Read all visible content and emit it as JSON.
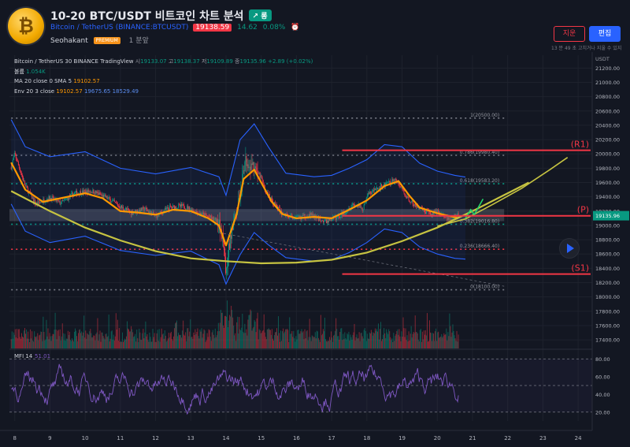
{
  "header": {
    "title": "10-20 BTC/USDT 비트코인 차트 분석",
    "trend_badge": "↗ 롱",
    "symbol_name": "Bitcoin / TetherUS",
    "symbol_code": "(BINANCE:BTCUSDT)",
    "price": "19138.59",
    "change": "14.62",
    "change_pct": "0.08%",
    "author": "Seohakant",
    "author_badge": "PREMIUM",
    "posted": "1 분앞",
    "delete_label": "지운",
    "edit_label": "편집",
    "edit_note": "13 분 49 초 고치거나 지울 수 있지"
  },
  "legend": {
    "symbol": "Bitcoin / TetherUS",
    "interval": "30",
    "exchange": "BINANCE",
    "source": "TradingView",
    "o_label": "시",
    "o": "19133.07",
    "h_label": "고",
    "h": "19138.37",
    "l_label": "저",
    "l": "19109.89",
    "c_label": "종",
    "c": "19135.96",
    "chg": "+2.89 (+0.02%)",
    "vol_label": "볼륨",
    "vol": "1.054K",
    "ma_label": "MA 20 close 0 SMA 5",
    "ma": "19102.57",
    "env_label": "Env 20 3 close",
    "env_mid": "19102.57",
    "env_up": "19675.65",
    "env_low": "18529.49"
  },
  "colors": {
    "background": "#131722",
    "up": "#089981",
    "down": "#f23645",
    "ma": "#ff9800",
    "envelope": "#2962ff",
    "curve": "#c6c341",
    "mfi": "#7e57c2"
  },
  "chart_data": {
    "type": "candlestick",
    "currency": "USDT",
    "last_price": "19135.96",
    "x": {
      "ticks": [
        "8",
        "9",
        "10",
        "11",
        "12",
        "13",
        "14",
        "15",
        "16",
        "17",
        "18",
        "19",
        "20",
        "21",
        "22",
        "23",
        "24"
      ],
      "tick_values": [
        8,
        9,
        10,
        11,
        12,
        13,
        14,
        15,
        16,
        17,
        18,
        19,
        20,
        21,
        22,
        23,
        24
      ],
      "range": [
        7.85,
        24.4
      ],
      "last_bar": 20.6
    },
    "y": {
      "range": [
        17280,
        21380
      ],
      "ticks": [
        "21200.00",
        "21000.00",
        "20800.00",
        "20600.00",
        "20400.00",
        "20200.00",
        "20000.00",
        "19800.00",
        "19600.00",
        "19400.00",
        "19200.00",
        "19000.00",
        "18800.00",
        "18600.00",
        "18400.00",
        "18200.00",
        "18000.00",
        "17800.00",
        "17600.00",
        "17400.00"
      ],
      "tick_values": [
        21200,
        21000,
        20800,
        20600,
        20400,
        20200,
        20000,
        19800,
        19600,
        19400,
        19200,
        19000,
        18800,
        18600,
        18400,
        18200,
        18000,
        17800,
        17600,
        17400
      ]
    },
    "close_path": [
      [
        7.9,
        19820
      ],
      [
        8.0,
        20000
      ],
      [
        8.3,
        19550
      ],
      [
        8.6,
        19300
      ],
      [
        9.0,
        19390
      ],
      [
        9.3,
        19310
      ],
      [
        9.7,
        19450
      ],
      [
        10.2,
        19480
      ],
      [
        10.6,
        19390
      ],
      [
        11.0,
        19260
      ],
      [
        11.3,
        19180
      ],
      [
        11.7,
        19230
      ],
      [
        12.0,
        19130
      ],
      [
        12.4,
        19250
      ],
      [
        12.8,
        19270
      ],
      [
        13.2,
        19180
      ],
      [
        13.5,
        19120
      ],
      [
        13.8,
        19050
      ],
      [
        13.95,
        18720
      ],
      [
        14.0,
        18250
      ],
      [
        14.05,
        18600
      ],
      [
        14.2,
        19000
      ],
      [
        14.4,
        19450
      ],
      [
        14.55,
        19900
      ],
      [
        14.75,
        19820
      ],
      [
        15.0,
        19670
      ],
      [
        15.1,
        19500
      ],
      [
        15.3,
        19350
      ],
      [
        15.6,
        19160
      ],
      [
        16.0,
        19100
      ],
      [
        16.4,
        19150
      ],
      [
        16.8,
        19050
      ],
      [
        17.2,
        19120
      ],
      [
        17.4,
        19200
      ],
      [
        17.6,
        19300
      ],
      [
        17.9,
        19230
      ],
      [
        18.0,
        19420
      ],
      [
        18.3,
        19520
      ],
      [
        18.6,
        19580
      ],
      [
        18.8,
        19650
      ],
      [
        19.0,
        19500
      ],
      [
        19.2,
        19350
      ],
      [
        19.5,
        19230
      ],
      [
        19.8,
        19160
      ],
      [
        20.0,
        19200
      ],
      [
        20.3,
        19090
      ],
      [
        20.55,
        19135
      ]
    ],
    "ma_path": [
      [
        7.9,
        19880
      ],
      [
        8.3,
        19500
      ],
      [
        8.8,
        19330
      ],
      [
        9.3,
        19380
      ],
      [
        10.0,
        19450
      ],
      [
        10.5,
        19380
      ],
      [
        11.0,
        19200
      ],
      [
        11.5,
        19180
      ],
      [
        12.0,
        19150
      ],
      [
        12.5,
        19220
      ],
      [
        13.0,
        19200
      ],
      [
        13.5,
        19100
      ],
      [
        13.8,
        19000
      ],
      [
        14.0,
        18720
      ],
      [
        14.3,
        19150
      ],
      [
        14.5,
        19650
      ],
      [
        14.8,
        19780
      ],
      [
        15.0,
        19600
      ],
      [
        15.3,
        19330
      ],
      [
        15.6,
        19160
      ],
      [
        16.0,
        19100
      ],
      [
        16.5,
        19120
      ],
      [
        17.0,
        19100
      ],
      [
        17.5,
        19220
      ],
      [
        18.0,
        19350
      ],
      [
        18.5,
        19550
      ],
      [
        18.9,
        19620
      ],
      [
        19.2,
        19420
      ],
      [
        19.5,
        19250
      ],
      [
        20.0,
        19170
      ],
      [
        20.6,
        19102
      ]
    ],
    "env_upper_path": [
      [
        7.9,
        20480
      ],
      [
        8.3,
        20100
      ],
      [
        9.0,
        19960
      ],
      [
        10.0,
        20030
      ],
      [
        11.0,
        19800
      ],
      [
        12.0,
        19720
      ],
      [
        13.0,
        19810
      ],
      [
        13.8,
        19680
      ],
      [
        14.0,
        19420
      ],
      [
        14.4,
        20200
      ],
      [
        14.8,
        20420
      ],
      [
        15.2,
        20100
      ],
      [
        15.7,
        19730
      ],
      [
        16.5,
        19680
      ],
      [
        17.0,
        19700
      ],
      [
        17.5,
        19800
      ],
      [
        18.0,
        19920
      ],
      [
        18.5,
        20130
      ],
      [
        19.0,
        20100
      ],
      [
        19.5,
        19870
      ],
      [
        20.0,
        19760
      ],
      [
        20.5,
        19700
      ],
      [
        20.8,
        19676
      ]
    ],
    "env_lower_path": [
      [
        7.9,
        19300
      ],
      [
        8.3,
        18920
      ],
      [
        9.0,
        18760
      ],
      [
        10.0,
        18850
      ],
      [
        11.0,
        18650
      ],
      [
        12.0,
        18580
      ],
      [
        13.0,
        18640
      ],
      [
        13.8,
        18450
      ],
      [
        14.0,
        18180
      ],
      [
        14.4,
        18590
      ],
      [
        14.8,
        18900
      ],
      [
        15.2,
        18730
      ],
      [
        15.7,
        18550
      ],
      [
        16.5,
        18500
      ],
      [
        17.0,
        18520
      ],
      [
        17.5,
        18620
      ],
      [
        18.0,
        18760
      ],
      [
        18.5,
        18950
      ],
      [
        19.0,
        18900
      ],
      [
        19.5,
        18700
      ],
      [
        20.0,
        18600
      ],
      [
        20.5,
        18540
      ],
      [
        20.8,
        18529
      ]
    ],
    "fib_levels": [
      {
        "label": "1(20500.00)",
        "value": 20500,
        "color": "#787b86"
      },
      {
        "label": "0.786(19980.40)",
        "value": 19980.4,
        "color": "#787b86"
      },
      {
        "label": "0.618(19583.20)",
        "value": 19583.2,
        "color": "#089981"
      },
      {
        "label": "0.382(19016.80)",
        "value": 19016.8,
        "color": "#089981"
      },
      {
        "label": "0.236(18666.40)",
        "value": 18666.4,
        "color": "#f23645"
      },
      {
        "label": "0(18100.00)",
        "value": 18100,
        "color": "#787b86"
      }
    ],
    "fib_x_range": [
      7.9,
      21.9
    ],
    "levels": [
      {
        "label": "(R1)",
        "value": 20050,
        "from": 17.3,
        "to": 24.4
      },
      {
        "label": "(P)",
        "value": 19135,
        "from": 17.3,
        "to": 24.4
      },
      {
        "label": "(S1)",
        "value": 18320,
        "from": 17.3,
        "to": 24.4
      }
    ],
    "zone": {
      "from": 19060,
      "to": 19230,
      "x_from": 7.85,
      "x_to": 21.9
    },
    "curve_path": [
      [
        7.9,
        19480
      ],
      [
        9.0,
        19200
      ],
      [
        10.0,
        18970
      ],
      [
        11.0,
        18790
      ],
      [
        12.0,
        18640
      ],
      [
        13.0,
        18540
      ],
      [
        14.0,
        18500
      ],
      [
        15.0,
        18470
      ],
      [
        16.0,
        18480
      ],
      [
        17.0,
        18520
      ],
      [
        18.0,
        18620
      ],
      [
        19.0,
        18780
      ],
      [
        20.0,
        18970
      ],
      [
        21.0,
        19200
      ],
      [
        22.0,
        19450
      ],
      [
        22.6,
        19600
      ]
    ],
    "curve2_path": [
      [
        20.0,
        18990
      ],
      [
        20.8,
        19090
      ],
      [
        21.6,
        19300
      ],
      [
        22.4,
        19520
      ],
      [
        23.2,
        19780
      ],
      [
        23.7,
        19950
      ]
    ],
    "trend_line": [
      [
        13.8,
        18900
      ],
      [
        21.9,
        18150
      ]
    ],
    "projection_arrow": [
      [
        20.8,
        19100
      ],
      [
        20.95,
        19220
      ],
      [
        21.05,
        19150
      ],
      [
        21.3,
        19370
      ]
    ],
    "mfi": {
      "label": "MFI 14",
      "value": "51.01",
      "range": [
        10,
        90
      ],
      "levels": [
        80,
        50,
        20
      ],
      "ticks": [
        "80.00",
        "60.00",
        "40.00",
        "20.00"
      ],
      "tick_values": [
        80,
        60,
        40,
        20
      ]
    }
  }
}
